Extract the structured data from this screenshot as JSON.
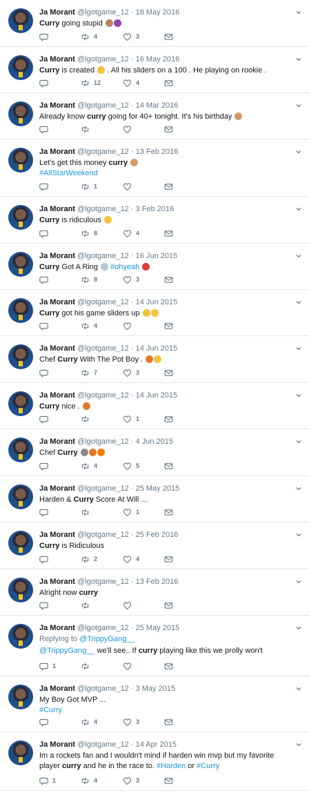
{
  "tweets": [
    {
      "name": "Ja Morant",
      "handle": "@lgotgame_12",
      "date": "18 May 2016",
      "reply_to": "",
      "parts": [
        {
          "t": "Curry",
          "b": 1
        },
        {
          "t": " going stupid "
        }
      ],
      "emoji": [
        "monkey",
        "devil"
      ],
      "replies": "",
      "retweets": "4",
      "likes": "3"
    },
    {
      "name": "Ja Morant",
      "handle": "@lgotgame_12",
      "date": "16 May 2016",
      "reply_to": "",
      "parts": [
        {
          "t": "Curry",
          "b": 1
        },
        {
          "t": " is created "
        }
      ],
      "emoji": [
        "laugh"
      ],
      "after": " . All his sliders on a 100 . He playing on rookie .",
      "replies": "",
      "retweets": "12",
      "likes": "4"
    },
    {
      "name": "Ja Morant",
      "handle": "@lgotgame_12",
      "date": "14 Mar 2016",
      "reply_to": "",
      "parts": [
        {
          "t": "Already know "
        },
        {
          "t": "curry",
          "b": 1
        },
        {
          "t": " going for 40+ tonight. It's his birthday "
        }
      ],
      "emoji": [
        "muscle"
      ],
      "replies": "",
      "retweets": "",
      "likes": ""
    },
    {
      "name": "Ja Morant",
      "handle": "@lgotgame_12",
      "date": "13 Feb 2016",
      "reply_to": "",
      "parts": [
        {
          "t": "Let's get this money "
        },
        {
          "t": "curry",
          "b": 1
        },
        {
          "t": " "
        }
      ],
      "emoji": [
        "muscle"
      ],
      "line2": "#AllStarWeekend",
      "replies": "",
      "retweets": "1",
      "likes": ""
    },
    {
      "name": "Ja Morant",
      "handle": "@lgotgame_12",
      "date": "3 Feb 2016",
      "reply_to": "",
      "parts": [
        {
          "t": "Curry",
          "b": 1
        },
        {
          "t": " is ridiculous "
        }
      ],
      "emoji": [
        "laugh"
      ],
      "replies": "",
      "retweets": "8",
      "likes": "4"
    },
    {
      "name": "Ja Morant",
      "handle": "@lgotgame_12",
      "date": "16 Jun 2015",
      "reply_to": "",
      "parts": [
        {
          "t": "Curry",
          "b": 1
        },
        {
          "t": " Got A Ring "
        }
      ],
      "emoji": [
        "ring"
      ],
      "hashtag": " #ohyeah ",
      "emoji2": [
        "hundred"
      ],
      "replies": "",
      "retweets": "8",
      "likes": "3"
    },
    {
      "name": "Ja Morant",
      "handle": "@lgotgame_12",
      "date": "14 Jun 2015",
      "reply_to": "",
      "parts": [
        {
          "t": "Curry",
          "b": 1
        },
        {
          "t": " got his game sliders up "
        }
      ],
      "emoji": [
        "laugh",
        "laugh"
      ],
      "replies": "",
      "retweets": "4",
      "likes": ""
    },
    {
      "name": "Ja Morant",
      "handle": "@lgotgame_12",
      "date": "14 Jun 2015",
      "reply_to": "",
      "parts": [
        {
          "t": "Chef "
        },
        {
          "t": "Curry",
          "b": 1
        },
        {
          "t": " With The Pot Boy . "
        }
      ],
      "emoji": [
        "ball",
        "laugh"
      ],
      "replies": "",
      "retweets": "7",
      "likes": "3"
    },
    {
      "name": "Ja Morant",
      "handle": "@lgotgame_12",
      "date": "14 Jun 2015",
      "reply_to": "",
      "parts": [
        {
          "t": "Curry",
          "b": 1
        },
        {
          "t": " nice . "
        }
      ],
      "emoji": [
        "ball"
      ],
      "replies": "",
      "retweets": "",
      "likes": "1"
    },
    {
      "name": "Ja Morant",
      "handle": "@lgotgame_12",
      "date": "4 Jun 2015",
      "reply_to": "",
      "parts": [
        {
          "t": "Chef "
        },
        {
          "t": "Curry",
          "b": 1
        },
        {
          "t": " "
        }
      ],
      "emoji": [
        "fork",
        "ball",
        "fire"
      ],
      "replies": "",
      "retweets": "4",
      "likes": "5"
    },
    {
      "name": "Ja Morant",
      "handle": "@lgotgame_12",
      "date": "25 May 2015",
      "reply_to": "",
      "parts": [
        {
          "t": "Harden & "
        },
        {
          "t": "Curry",
          "b": 1
        },
        {
          "t": " Score At Will ..."
        }
      ],
      "emoji": [],
      "replies": "",
      "retweets": "",
      "likes": "1"
    },
    {
      "name": "Ja Morant",
      "handle": "@lgotgame_12",
      "date": "25 Feb 2016",
      "reply_to": "",
      "parts": [
        {
          "t": "Curry",
          "b": 1
        },
        {
          "t": " is Ridiculous"
        }
      ],
      "emoji": [],
      "replies": "",
      "retweets": "2",
      "likes": "4"
    },
    {
      "name": "Ja Morant",
      "handle": "@lgotgame_12",
      "date": "13 Feb 2016",
      "reply_to": "",
      "parts": [
        {
          "t": "Alright now "
        },
        {
          "t": "curry",
          "b": 1
        }
      ],
      "emoji": [],
      "replies": "",
      "retweets": "",
      "likes": ""
    },
    {
      "name": "Ja Morant",
      "handle": "@lgotgame_12",
      "date": "25 May 2015",
      "reply_to": "@TrippyGang__",
      "parts": [
        {
          "t": "@TrippyGang__",
          "l": 1
        },
        {
          "t": " we'll see.. If "
        },
        {
          "t": "curry",
          "b": 1
        },
        {
          "t": " playing like this we prolly won't"
        }
      ],
      "emoji": [],
      "replies": "1",
      "retweets": "",
      "likes": ""
    },
    {
      "name": "Ja Morant",
      "handle": "@lgotgame_12",
      "date": "3 May 2015",
      "reply_to": "",
      "parts": [
        {
          "t": "My Boy Got MVP ..."
        }
      ],
      "emoji": [],
      "line2": "#Curry",
      "replies": "",
      "retweets": "4",
      "likes": "3"
    },
    {
      "name": "Ja Morant",
      "handle": "@lgotgame_12",
      "date": "14 Apr 2015",
      "reply_to": "",
      "parts": [
        {
          "t": "Im a rockets fan and I wouldn't mind if harden win mvp but my favorite player "
        },
        {
          "t": "curry",
          "b": 1
        },
        {
          "t": " and he in the race to. "
        },
        {
          "t": "#Harden",
          "l": 1
        },
        {
          "t": " or "
        },
        {
          "t": "#Curry",
          "l": 1
        }
      ],
      "emoji": [],
      "replies": "1",
      "retweets": "4",
      "likes": "3"
    }
  ],
  "labels": {
    "replying_to": "Replying to"
  },
  "colors": {
    "link": "#1b95e0",
    "meta": "#657786",
    "border": "#e1e8ed"
  },
  "icons": {
    "reply": "reply-icon",
    "retweet": "retweet-icon",
    "like": "heart-icon",
    "dm": "envelope-icon",
    "menu": "chevron-down-icon"
  }
}
